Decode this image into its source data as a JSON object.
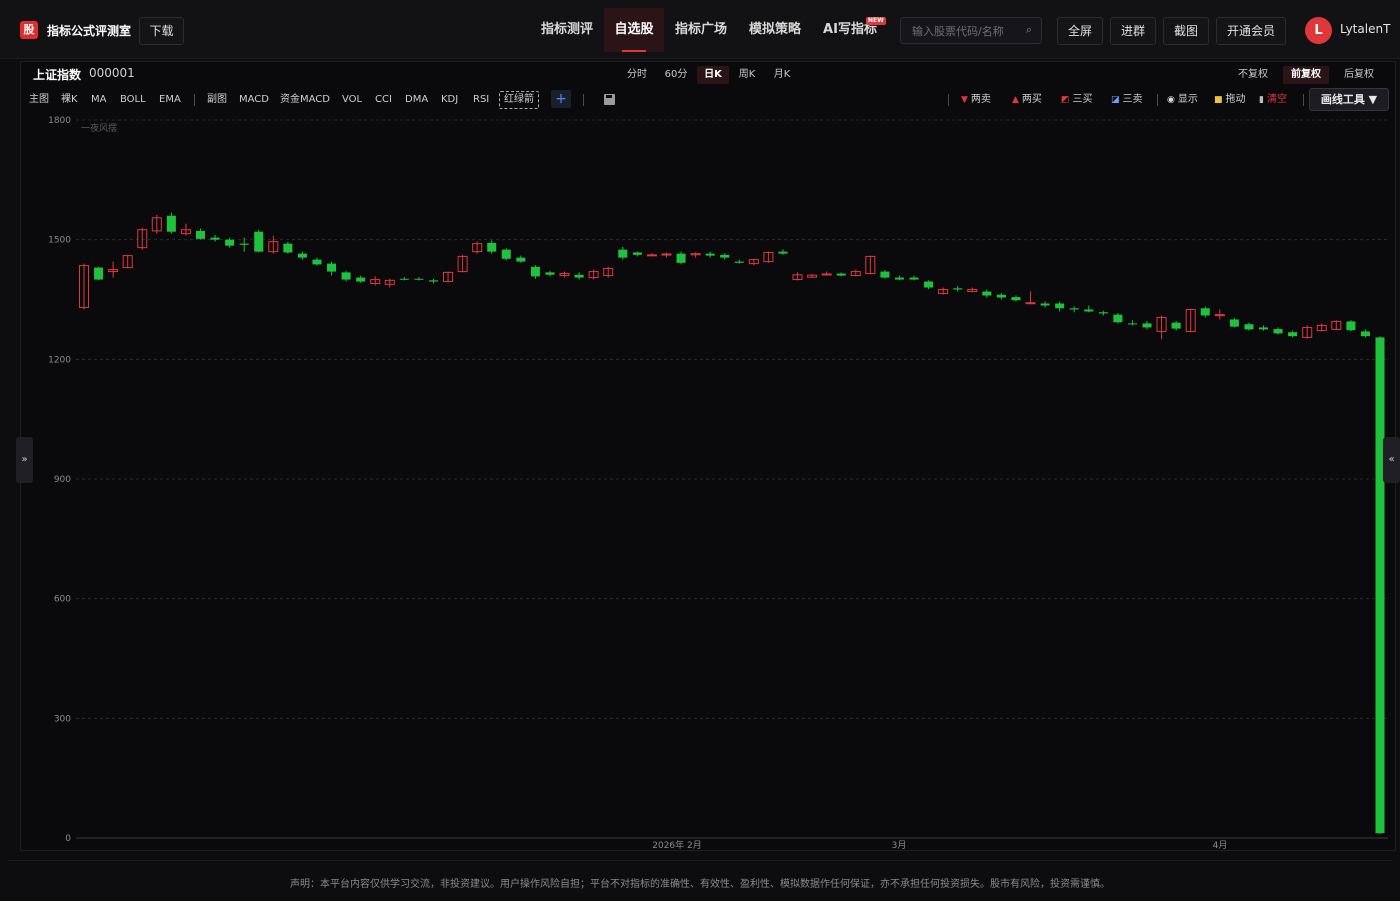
{
  "app": {
    "logo_char": "股",
    "brand": "指标公式评测室",
    "download": "下载"
  },
  "nav": [
    {
      "label": "指标测评",
      "active": false
    },
    {
      "label": "自选股",
      "active": true
    },
    {
      "label": "指标广场",
      "active": false
    },
    {
      "label": "模拟策略",
      "active": false
    },
    {
      "label": "AI写指标",
      "active": false
    }
  ],
  "nav_badge": "NEW",
  "search": {
    "placeholder": "输入股票代码/名称"
  },
  "actions": [
    "全屏",
    "进群",
    "截图",
    "开通会员"
  ],
  "user": {
    "initial": "L",
    "name": "LytalenT"
  },
  "stock": {
    "name": "上证指数",
    "code": "000001"
  },
  "periods": [
    {
      "label": "分时",
      "active": false
    },
    {
      "label": "60分",
      "active": false
    },
    {
      "label": "日K",
      "active": true
    },
    {
      "label": "周K",
      "active": false
    },
    {
      "label": "月K",
      "active": false
    }
  ],
  "rights": [
    {
      "label": "不复权",
      "active": false
    },
    {
      "label": "前复权",
      "active": true
    },
    {
      "label": "后复权",
      "active": false
    }
  ],
  "indicators_main": [
    "主图",
    "裸K",
    "MA",
    "BOLL",
    "EMA"
  ],
  "indicators_sub": [
    "副图",
    "MACD",
    "资金MACD",
    "VOL",
    "CCI",
    "DMA",
    "KDJ",
    "RSI"
  ],
  "indicator_selected": "红绿箭",
  "tools": {
    "two_sell": "两卖",
    "two_buy": "两买",
    "three_buy": "三买",
    "three_sell": "三卖",
    "show": "显示",
    "drag": "拖动",
    "clear": "清空",
    "draw_tools": "画线工具 ▼"
  },
  "colors": {
    "up": "#e0383a",
    "down": "#1ec23c",
    "accent": "#e0383a",
    "bg": "#0a0a0c"
  },
  "chart_data": {
    "type": "candlestick",
    "watermark": "一夜风摆",
    "ylim": [
      0,
      1800
    ],
    "yticks": [
      0,
      300,
      600,
      900,
      1200,
      1500,
      1800
    ],
    "xticks": [
      "2026年 2月",
      "3月",
      "4月"
    ],
    "candles": [
      {
        "o": 1330,
        "h": 1440,
        "l": 1325,
        "c": 1435
      },
      {
        "o": 1430,
        "h": 1432,
        "l": 1398,
        "c": 1400
      },
      {
        "o": 1420,
        "h": 1445,
        "l": 1405,
        "c": 1425
      },
      {
        "o": 1430,
        "h": 1462,
        "l": 1428,
        "c": 1460
      },
      {
        "o": 1480,
        "h": 1530,
        "l": 1475,
        "c": 1525
      },
      {
        "o": 1522,
        "h": 1562,
        "l": 1515,
        "c": 1555
      },
      {
        "o": 1560,
        "h": 1568,
        "l": 1515,
        "c": 1520
      },
      {
        "o": 1515,
        "h": 1540,
        "l": 1510,
        "c": 1525
      },
      {
        "o": 1522,
        "h": 1528,
        "l": 1500,
        "c": 1502
      },
      {
        "o": 1505,
        "h": 1512,
        "l": 1495,
        "c": 1500
      },
      {
        "o": 1500,
        "h": 1505,
        "l": 1480,
        "c": 1485
      },
      {
        "o": 1490,
        "h": 1505,
        "l": 1470,
        "c": 1487
      },
      {
        "o": 1520,
        "h": 1525,
        "l": 1468,
        "c": 1470
      },
      {
        "o": 1470,
        "h": 1510,
        "l": 1465,
        "c": 1495
      },
      {
        "o": 1490,
        "h": 1495,
        "l": 1465,
        "c": 1468
      },
      {
        "o": 1465,
        "h": 1470,
        "l": 1450,
        "c": 1455
      },
      {
        "o": 1450,
        "h": 1455,
        "l": 1435,
        "c": 1438
      },
      {
        "o": 1440,
        "h": 1445,
        "l": 1410,
        "c": 1420
      },
      {
        "o": 1418,
        "h": 1422,
        "l": 1395,
        "c": 1400
      },
      {
        "o": 1405,
        "h": 1410,
        "l": 1392,
        "c": 1395
      },
      {
        "o": 1390,
        "h": 1408,
        "l": 1385,
        "c": 1400
      },
      {
        "o": 1388,
        "h": 1402,
        "l": 1380,
        "c": 1398
      },
      {
        "o": 1402,
        "h": 1406,
        "l": 1398,
        "c": 1401
      },
      {
        "o": 1402,
        "h": 1406,
        "l": 1398,
        "c": 1400
      },
      {
        "o": 1398,
        "h": 1402,
        "l": 1390,
        "c": 1395
      },
      {
        "o": 1395,
        "h": 1420,
        "l": 1393,
        "c": 1418
      },
      {
        "o": 1420,
        "h": 1462,
        "l": 1418,
        "c": 1458
      },
      {
        "o": 1470,
        "h": 1495,
        "l": 1465,
        "c": 1490
      },
      {
        "o": 1492,
        "h": 1498,
        "l": 1465,
        "c": 1470
      },
      {
        "o": 1475,
        "h": 1478,
        "l": 1448,
        "c": 1452
      },
      {
        "o": 1455,
        "h": 1460,
        "l": 1442,
        "c": 1445
      },
      {
        "o": 1432,
        "h": 1436,
        "l": 1402,
        "c": 1408
      },
      {
        "o": 1418,
        "h": 1422,
        "l": 1408,
        "c": 1412
      },
      {
        "o": 1410,
        "h": 1420,
        "l": 1405,
        "c": 1415
      },
      {
        "o": 1412,
        "h": 1418,
        "l": 1400,
        "c": 1405
      },
      {
        "o": 1405,
        "h": 1425,
        "l": 1400,
        "c": 1420
      },
      {
        "o": 1410,
        "h": 1432,
        "l": 1405,
        "c": 1428
      },
      {
        "o": 1475,
        "h": 1482,
        "l": 1450,
        "c": 1455
      },
      {
        "o": 1468,
        "h": 1470,
        "l": 1458,
        "c": 1462
      },
      {
        "o": 1460,
        "h": 1466,
        "l": 1458,
        "c": 1462
      },
      {
        "o": 1462,
        "h": 1468,
        "l": 1455,
        "c": 1464
      },
      {
        "o": 1465,
        "h": 1470,
        "l": 1438,
        "c": 1442
      },
      {
        "o": 1462,
        "h": 1468,
        "l": 1455,
        "c": 1465
      },
      {
        "o": 1465,
        "h": 1470,
        "l": 1455,
        "c": 1460
      },
      {
        "o": 1462,
        "h": 1466,
        "l": 1450,
        "c": 1455
      },
      {
        "o": 1445,
        "h": 1450,
        "l": 1440,
        "c": 1442
      },
      {
        "o": 1440,
        "h": 1452,
        "l": 1436,
        "c": 1450
      },
      {
        "o": 1445,
        "h": 1470,
        "l": 1442,
        "c": 1468
      },
      {
        "o": 1470,
        "h": 1476,
        "l": 1462,
        "c": 1465
      },
      {
        "o": 1400,
        "h": 1418,
        "l": 1398,
        "c": 1412
      },
      {
        "o": 1406,
        "h": 1414,
        "l": 1404,
        "c": 1411
      },
      {
        "o": 1412,
        "h": 1420,
        "l": 1410,
        "c": 1414
      },
      {
        "o": 1415,
        "h": 1418,
        "l": 1408,
        "c": 1410
      },
      {
        "o": 1410,
        "h": 1425,
        "l": 1408,
        "c": 1420
      },
      {
        "o": 1415,
        "h": 1460,
        "l": 1413,
        "c": 1458
      },
      {
        "o": 1420,
        "h": 1424,
        "l": 1402,
        "c": 1405
      },
      {
        "o": 1405,
        "h": 1410,
        "l": 1398,
        "c": 1400
      },
      {
        "o": 1405,
        "h": 1410,
        "l": 1398,
        "c": 1400
      },
      {
        "o": 1395,
        "h": 1398,
        "l": 1376,
        "c": 1380
      },
      {
        "o": 1365,
        "h": 1380,
        "l": 1362,
        "c": 1375
      },
      {
        "o": 1378,
        "h": 1384,
        "l": 1370,
        "c": 1375
      },
      {
        "o": 1370,
        "h": 1380,
        "l": 1368,
        "c": 1375
      },
      {
        "o": 1370,
        "h": 1375,
        "l": 1355,
        "c": 1360
      },
      {
        "o": 1362,
        "h": 1366,
        "l": 1350,
        "c": 1355
      },
      {
        "o": 1356,
        "h": 1360,
        "l": 1345,
        "c": 1348
      },
      {
        "o": 1340,
        "h": 1370,
        "l": 1338,
        "c": 1342
      },
      {
        "o": 1340,
        "h": 1345,
        "l": 1330,
        "c": 1335
      },
      {
        "o": 1340,
        "h": 1345,
        "l": 1320,
        "c": 1328
      },
      {
        "o": 1328,
        "h": 1333,
        "l": 1318,
        "c": 1325
      },
      {
        "o": 1325,
        "h": 1335,
        "l": 1318,
        "c": 1320
      },
      {
        "o": 1318,
        "h": 1322,
        "l": 1310,
        "c": 1315
      },
      {
        "o": 1312,
        "h": 1316,
        "l": 1290,
        "c": 1293
      },
      {
        "o": 1290,
        "h": 1298,
        "l": 1285,
        "c": 1288
      },
      {
        "o": 1290,
        "h": 1296,
        "l": 1275,
        "c": 1280
      },
      {
        "o": 1270,
        "h": 1310,
        "l": 1250,
        "c": 1305
      },
      {
        "o": 1292,
        "h": 1296,
        "l": 1272,
        "c": 1277
      },
      {
        "o": 1270,
        "h": 1327,
        "l": 1268,
        "c": 1325
      },
      {
        "o": 1328,
        "h": 1332,
        "l": 1305,
        "c": 1310
      },
      {
        "o": 1310,
        "h": 1325,
        "l": 1300,
        "c": 1312
      },
      {
        "o": 1300,
        "h": 1304,
        "l": 1280,
        "c": 1282
      },
      {
        "o": 1288,
        "h": 1292,
        "l": 1272,
        "c": 1275
      },
      {
        "o": 1280,
        "h": 1285,
        "l": 1272,
        "c": 1275
      },
      {
        "o": 1276,
        "h": 1280,
        "l": 1262,
        "c": 1265
      },
      {
        "o": 1268,
        "h": 1272,
        "l": 1255,
        "c": 1258
      },
      {
        "o": 1255,
        "h": 1285,
        "l": 1252,
        "c": 1280
      },
      {
        "o": 1272,
        "h": 1290,
        "l": 1270,
        "c": 1285
      },
      {
        "o": 1275,
        "h": 1298,
        "l": 1273,
        "c": 1295
      },
      {
        "o": 1295,
        "h": 1298,
        "l": 1270,
        "c": 1273
      },
      {
        "o": 1270,
        "h": 1275,
        "l": 1255,
        "c": 1258
      },
      {
        "o": 1255,
        "h": 1258,
        "l": 10,
        "c": 12
      }
    ]
  },
  "footer": {
    "disclaimer": "声明：本平台内容仅供学习交流，非投资建议。用户操作风险自担；平台不对指标的准确性、有效性、盈利性、模拟数据作任何保证，亦不承担任何投资损失。股市有风险，投资需谨慎。"
  },
  "side": {
    "left_arrow": "»",
    "right_arrow": "«"
  }
}
